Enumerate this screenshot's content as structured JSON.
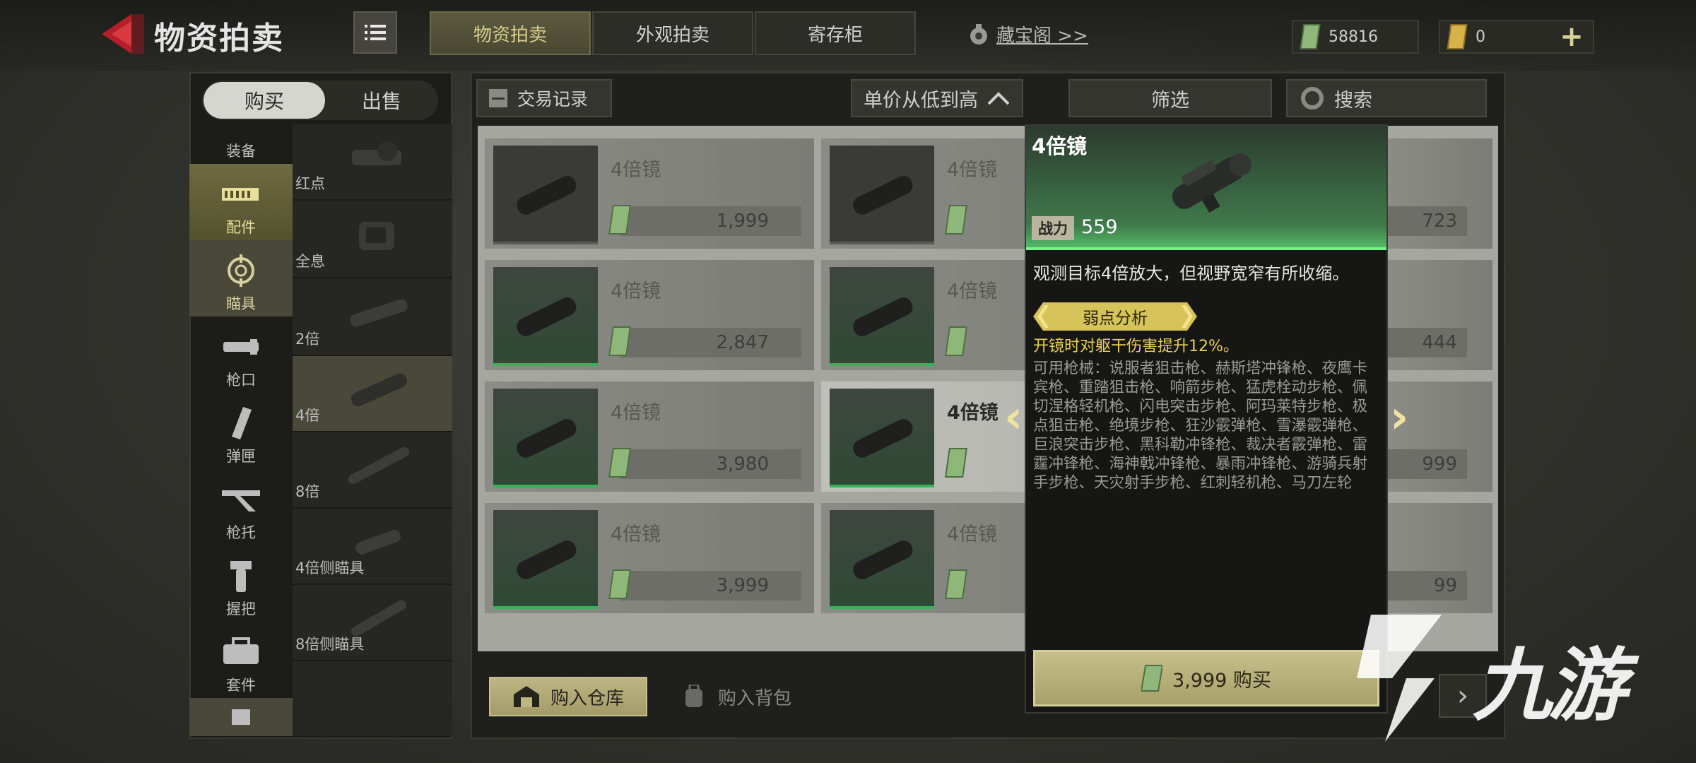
{
  "header": {
    "title": "物资拍卖",
    "tabs": [
      {
        "label": "物资拍卖",
        "active": true
      },
      {
        "label": "外观拍卖",
        "active": false
      },
      {
        "label": "寄存柜",
        "active": false
      }
    ],
    "treasure_link": "藏宝阁 >>",
    "currencies": [
      {
        "icon": "green-currency-icon",
        "value": "58816",
        "color": "#8fb77a"
      },
      {
        "icon": "gold-currency-icon",
        "value": "0",
        "color": "#d6b24a"
      }
    ],
    "add_label": "+"
  },
  "left": {
    "buy_label": "购买",
    "sell_label": "出售",
    "categories": [
      {
        "label": "装备",
        "icon": "equipment-icon"
      },
      {
        "label": "配件",
        "icon": "rail-attachment-icon",
        "active": true
      },
      {
        "label": "瞄具",
        "icon": "crosshair-icon",
        "selected": true
      },
      {
        "label": "枪口",
        "icon": "muzzle-icon"
      },
      {
        "label": "弹匣",
        "icon": "magazine-icon"
      },
      {
        "label": "枪托",
        "icon": "stock-icon"
      },
      {
        "label": "握把",
        "icon": "grip-icon"
      },
      {
        "label": "套件",
        "icon": "kit-icon"
      },
      {
        "label": "",
        "icon": "more-icon"
      }
    ],
    "sub_items": [
      {
        "label": "红点"
      },
      {
        "label": "全息"
      },
      {
        "label": "2倍"
      },
      {
        "label": "4倍",
        "selected": true
      },
      {
        "label": "8倍"
      },
      {
        "label": "4倍侧瞄具"
      },
      {
        "label": "8倍侧瞄具"
      }
    ]
  },
  "toolbar": {
    "trade_log": "交易记录",
    "sort": "单价从低到高",
    "filter": "筛选",
    "search": "搜索"
  },
  "listings": [
    {
      "name": "4倍镜",
      "price": "1,999"
    },
    {
      "name": "4倍镜",
      "price": ""
    },
    {
      "name": "",
      "price": "723"
    },
    {
      "name": "4倍镜",
      "price": "2,847"
    },
    {
      "name": "4倍镜",
      "price": ""
    },
    {
      "name": "",
      "price": "444"
    },
    {
      "name": "4倍镜",
      "price": "3,980"
    },
    {
      "name": "4倍镜",
      "price": ""
    },
    {
      "name": "",
      "price": "999"
    },
    {
      "name": "4倍镜",
      "price": "3,999"
    },
    {
      "name": "4倍镜",
      "price": ""
    },
    {
      "name": "",
      "price": "99"
    }
  ],
  "bottom": {
    "store_warehouse": "购入仓库",
    "store_backpack": "购入背包",
    "next": "›"
  },
  "detail": {
    "title": "4倍镜",
    "power_label": "战力",
    "power_value": "559",
    "description": "观测目标4倍放大，但视野宽窄有所收缩。",
    "weak_badge": "弱点分析",
    "weak_desc": "开镜时对躯干伤害提升12%。",
    "guns": "可用枪械：说服者狙击枪、赫斯塔冲锋枪、夜鹰卡宾枪、重踏狙击枪、响箭步枪、猛虎栓动步枪、佩切涅格轻机枪、闪电突击步枪、阿玛莱特步枪、极点狙击枪、绝境步枪、狂沙霰弹枪、雪瀑霰弹枪、巨浪突击步枪、黑科勒冲锋枪、裁决者霰弹枪、雷霆冲锋枪、海神戟冲锋枪、暴雨冲锋枪、游骑兵射手步枪、天灾射手步枪、红刺轻机枪、马刀左轮",
    "buy_label": "3,999 购买",
    "prev": "‹",
    "next": "›",
    "accent": "#56c06a"
  },
  "watermark": {
    "text": "九游"
  }
}
